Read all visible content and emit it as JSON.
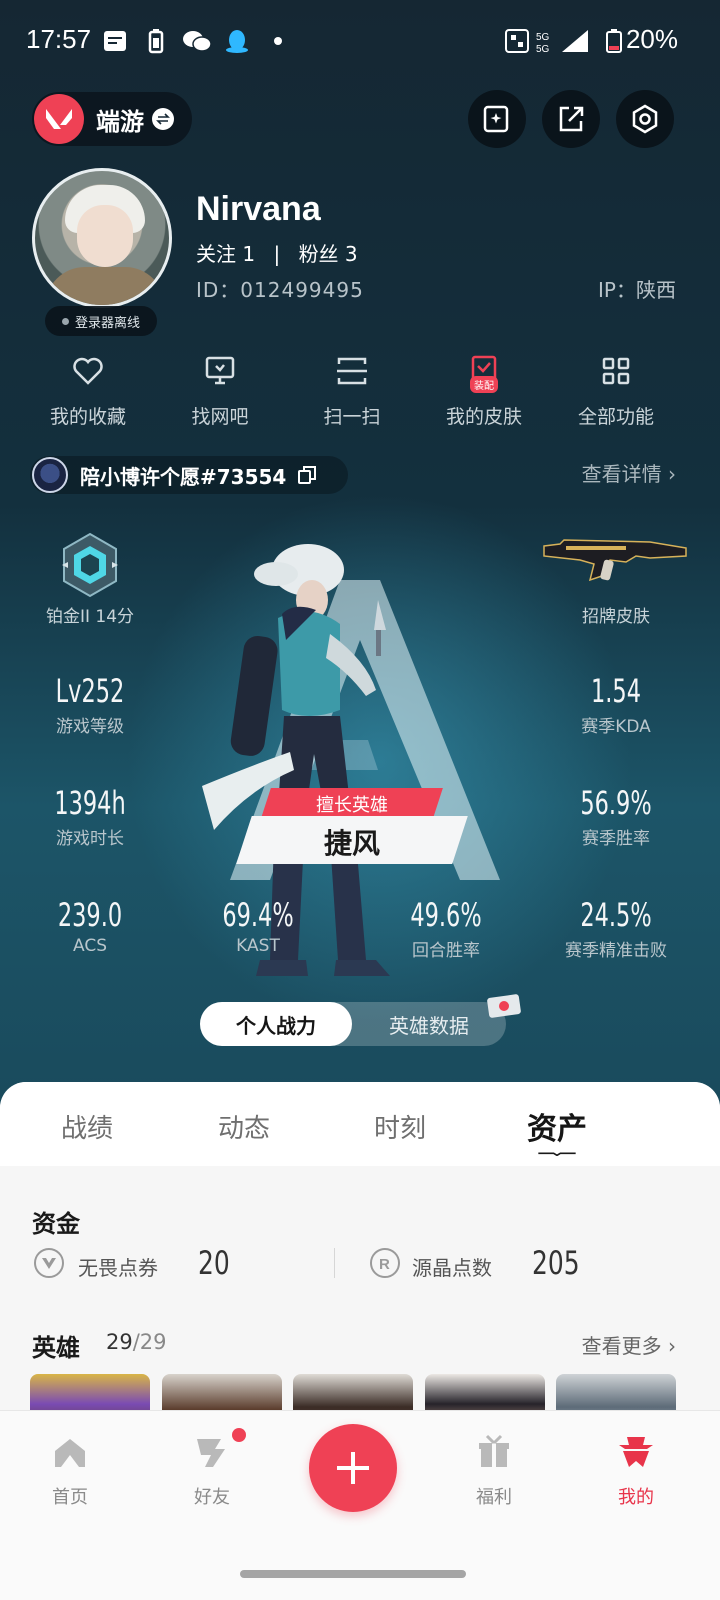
{
  "status_bar": {
    "time": "17:57",
    "network": "5G",
    "battery": "20%"
  },
  "header": {
    "mode_label": "端游"
  },
  "profile": {
    "name": "Nirvana",
    "follow_label": "关注",
    "follow_count": "1",
    "fans_label": "粉丝",
    "fans_count": "3",
    "id_text": "ID：012499495",
    "ip_text": "IP：陕西",
    "status": "登录器离线"
  },
  "shortcuts": [
    {
      "label": "我的收藏",
      "icon": "heart-icon"
    },
    {
      "label": "找网吧",
      "icon": "monitor-icon"
    },
    {
      "label": "扫一扫",
      "icon": "scan-icon"
    },
    {
      "label": "我的皮肤",
      "icon": "skin-icon",
      "badge": "装配"
    },
    {
      "label": "全部功能",
      "icon": "grid-icon"
    }
  ],
  "wish": {
    "text": "陪小博许个愿#73554",
    "view_detail": "查看详情"
  },
  "stats": {
    "rank_label": "铂金II 14分",
    "skin_label": "招牌皮肤",
    "level_value": "Lv252",
    "level_label": "游戏等级",
    "kda_value": "1.54",
    "kda_label": "赛季KDA",
    "hours_value": "1394h",
    "hours_label": "游戏时长",
    "winrate_value": "56.9%",
    "winrate_label": "赛季胜率",
    "acs_value": "239.0",
    "acs_label": "ACS",
    "kast_value": "69.4%",
    "kast_label": "KAST",
    "round_value": "49.6%",
    "round_label": "回合胜率",
    "precise_value": "24.5%",
    "precise_label": "赛季精准击败"
  },
  "best_agent": {
    "tag": "擅长英雄",
    "name": "捷风"
  },
  "toggle": {
    "active": "个人战力",
    "inactive": "英雄数据"
  },
  "tabs": [
    "战绩",
    "动态",
    "时刻",
    "资产"
  ],
  "funds": {
    "title": "资金",
    "vp_label": "无畏点券",
    "vp_value": "20",
    "rp_label": "源晶点数",
    "rp_value": "205"
  },
  "heroes": {
    "title": "英雄",
    "owned": "29",
    "total": "/29",
    "more": "查看更多"
  },
  "nav": [
    {
      "label": "首页",
      "icon": "home-icon"
    },
    {
      "label": "好友",
      "icon": "friends-icon"
    },
    {
      "label": "福利",
      "icon": "gift-icon"
    },
    {
      "label": "我的",
      "icon": "profile-icon"
    }
  ],
  "colors": {
    "accent": "#ef4155",
    "sheet_bg": "#f6f6f6"
  }
}
